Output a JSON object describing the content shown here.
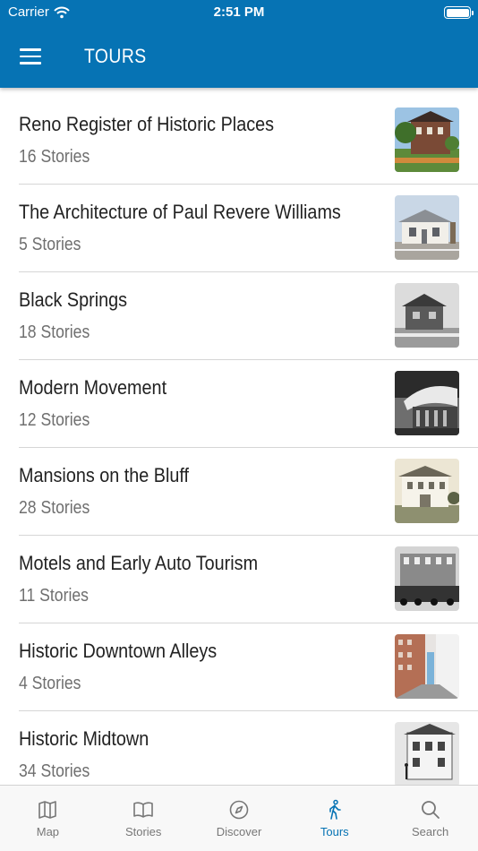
{
  "status_bar": {
    "carrier": "Carrier",
    "time": "2:51 PM"
  },
  "header": {
    "title": "TOURS",
    "menu_icon": "hamburger-menu-icon",
    "background": "#0673b4"
  },
  "tours": [
    {
      "title": "Reno Register of Historic Places",
      "count": "16 Stories"
    },
    {
      "title": "The Architecture of Paul Revere Williams",
      "count": "5 Stories"
    },
    {
      "title": "Black Springs",
      "count": "18 Stories"
    },
    {
      "title": "Modern Movement",
      "count": "12 Stories"
    },
    {
      "title": "Mansions on the Bluff",
      "count": "28 Stories"
    },
    {
      "title": "Motels and Early Auto Tourism",
      "count": "11 Stories"
    },
    {
      "title": "Historic Downtown Alleys",
      "count": "4 Stories"
    },
    {
      "title": "Historic Midtown",
      "count": "34 Stories"
    }
  ],
  "tabs": [
    {
      "label": "Map",
      "icon": "map-icon"
    },
    {
      "label": "Stories",
      "icon": "book-icon"
    },
    {
      "label": "Discover",
      "icon": "compass-icon"
    },
    {
      "label": "Tours",
      "icon": "walking-person-icon",
      "active": true
    },
    {
      "label": "Search",
      "icon": "search-icon"
    }
  ],
  "colors": {
    "accent": "#0673b4",
    "inactive_tab": "#777777",
    "separator": "#d6d6d6"
  }
}
